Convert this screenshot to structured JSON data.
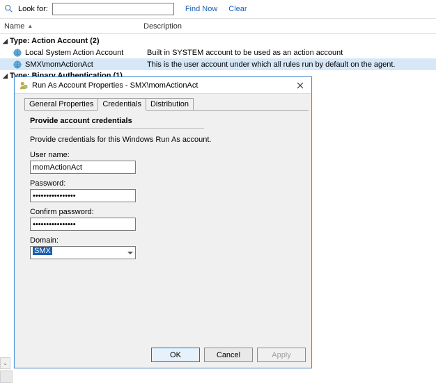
{
  "lookbar": {
    "label": "Look for:",
    "value": "",
    "find_now": "Find Now",
    "clear": "Clear"
  },
  "columns": {
    "name": "Name",
    "description": "Description"
  },
  "groups": [
    {
      "title": "Type: Action Account (2)",
      "rows": [
        {
          "name": "Local System Action Account",
          "desc": "Built in SYSTEM account to be used as an action account",
          "selected": false
        },
        {
          "name": "SMX\\momActionAct",
          "desc": "This is the user account under which all rules run by default on the agent.",
          "selected": true
        }
      ]
    },
    {
      "title": "Type: Binary Authentication (1)",
      "rows": []
    }
  ],
  "dialog": {
    "title": "Run As Account Properties - SMX\\momActionAct",
    "tabs": {
      "general": "General Properties",
      "credentials": "Credentials",
      "distribution": "Distribution"
    },
    "section": "Provide account credentials",
    "hint": "Provide credentials for this Windows Run As account.",
    "labels": {
      "user": "User name:",
      "password": "Password:",
      "confirm": "Confirm password:",
      "domain": "Domain:"
    },
    "values": {
      "user": "momActionAct",
      "password": "••••••••••••••••",
      "confirm": "••••••••••••••••",
      "domain": "SMX"
    },
    "buttons": {
      "ok": "OK",
      "cancel": "Cancel",
      "apply": "Apply"
    }
  },
  "bg_hint": "te"
}
